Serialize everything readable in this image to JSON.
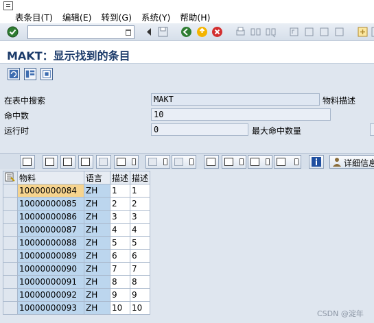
{
  "menu": {
    "items": [
      "表条目(T)",
      "编辑(E)",
      "转到(G)",
      "系统(Y)",
      "帮助(H)"
    ]
  },
  "command": {
    "value": ""
  },
  "title": "MAKT：显示找到的条目",
  "fields": {
    "search_table_label": "在表中搜索",
    "search_table_value": "MAKT",
    "search_table_desc": "物料描述",
    "hits_label": "命中数",
    "hits_value": "10",
    "runtime_label": "运行时",
    "runtime_value": "0",
    "max_hits_label": "最大命中数量"
  },
  "alv": {
    "detail_label": "详细信息"
  },
  "grid": {
    "headers": [
      "物料",
      "语言",
      "描述",
      "描述"
    ],
    "rows": [
      [
        "10000000084",
        "ZH",
        "1",
        "1"
      ],
      [
        "10000000085",
        "ZH",
        "2",
        "2"
      ],
      [
        "10000000086",
        "ZH",
        "3",
        "3"
      ],
      [
        "10000000087",
        "ZH",
        "4",
        "4"
      ],
      [
        "10000000088",
        "ZH",
        "5",
        "5"
      ],
      [
        "10000000089",
        "ZH",
        "6",
        "6"
      ],
      [
        "10000000090",
        "ZH",
        "7",
        "7"
      ],
      [
        "10000000091",
        "ZH",
        "8",
        "8"
      ],
      [
        "10000000092",
        "ZH",
        "9",
        "9"
      ],
      [
        "10000000093",
        "ZH",
        "10",
        "10"
      ]
    ]
  },
  "watermark": "CSDN @淀年",
  "colors": {
    "accent": "#1c3b6a",
    "key_column": "#bcd6ee",
    "focus_cell": "#f6d48f"
  }
}
